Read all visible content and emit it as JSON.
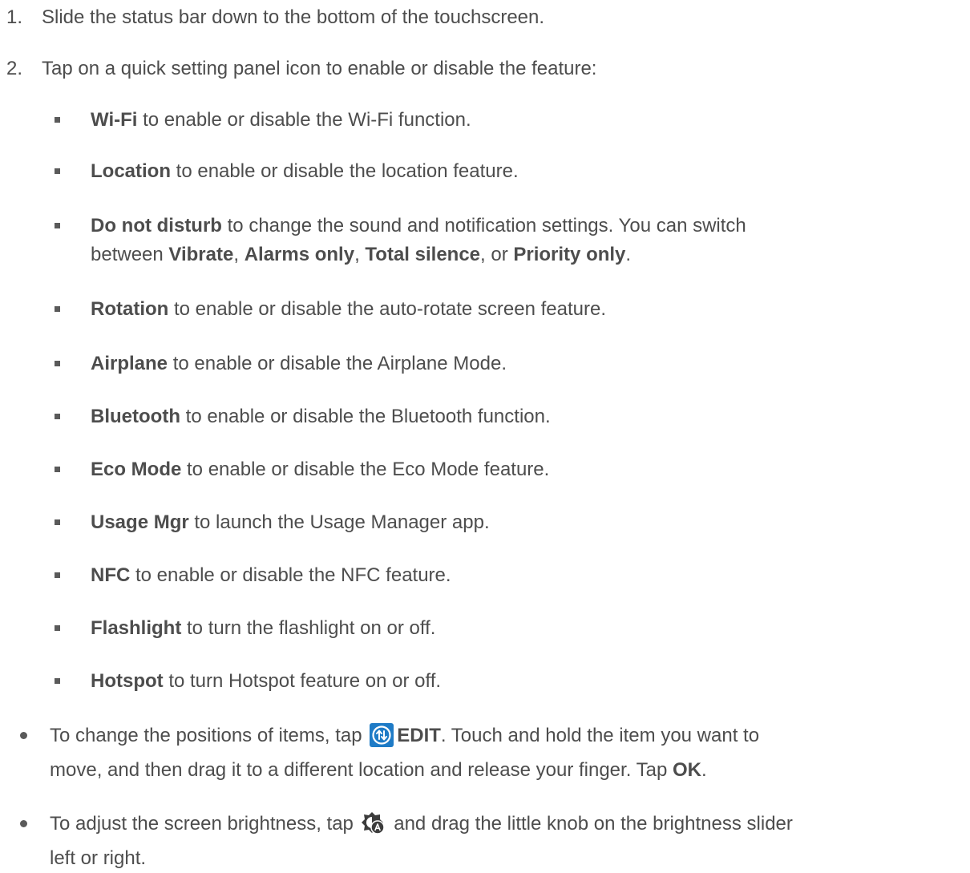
{
  "steps": [
    {
      "number": "1.",
      "text": "Slide the status bar down to the bottom of the touchscreen."
    },
    {
      "number": "2.",
      "text": "Tap on a quick setting panel icon to enable or disable the feature:"
    }
  ],
  "features": [
    {
      "name": "Wi-Fi",
      "desc": " to enable or disable the Wi-Fi function."
    },
    {
      "name": "Location",
      "desc": " to enable or disable the location feature."
    },
    {
      "name": "Do not disturb",
      "desc": " to change the sound and notification settings. You can switch",
      "line2_pre": "between ",
      "opt1": "Vibrate",
      "sep1": ", ",
      "opt2": "Alarms only",
      "sep2": ", ",
      "opt3": "Total silence",
      "sep3": ", or ",
      "opt4": "Priority only",
      "end": "."
    },
    {
      "name": "Rotation",
      "desc": " to enable or disable the auto-rotate screen feature."
    },
    {
      "name": "Airplane",
      "desc": " to enable or disable the Airplane Mode."
    },
    {
      "name": "Bluetooth",
      "desc": " to enable or disable the Bluetooth function."
    },
    {
      "name": "Eco Mode",
      "desc": " to enable or disable the Eco Mode feature."
    },
    {
      "name": "Usage Mgr",
      "desc": " to launch the Usage Manager app."
    },
    {
      "name": "NFC",
      "desc": " to enable or disable the NFC feature."
    },
    {
      "name": "Flashlight",
      "desc": " to turn the flashlight on or off."
    },
    {
      "name": "Hotspot",
      "desc": " to turn Hotspot feature on or off."
    }
  ],
  "bullets": {
    "edit": {
      "pre": "To change the positions of items, tap ",
      "icon": "edit-arrows-icon",
      "label": "EDIT",
      "post": ". Touch and hold the item you want to",
      "line2": "move, and then drag it to a different location and release your finger. Tap ",
      "ok": "OK",
      "end": "."
    },
    "brightness": {
      "pre": "To adjust the screen brightness, tap ",
      "icon": "auto-brightness-icon",
      "post": " and drag the little knob on the brightness slider",
      "line2": "left or right."
    }
  },
  "colors": {
    "text": "#4d4d4d",
    "icon_blue": "#1e7bc6",
    "icon_dark": "#3c3c3c"
  }
}
